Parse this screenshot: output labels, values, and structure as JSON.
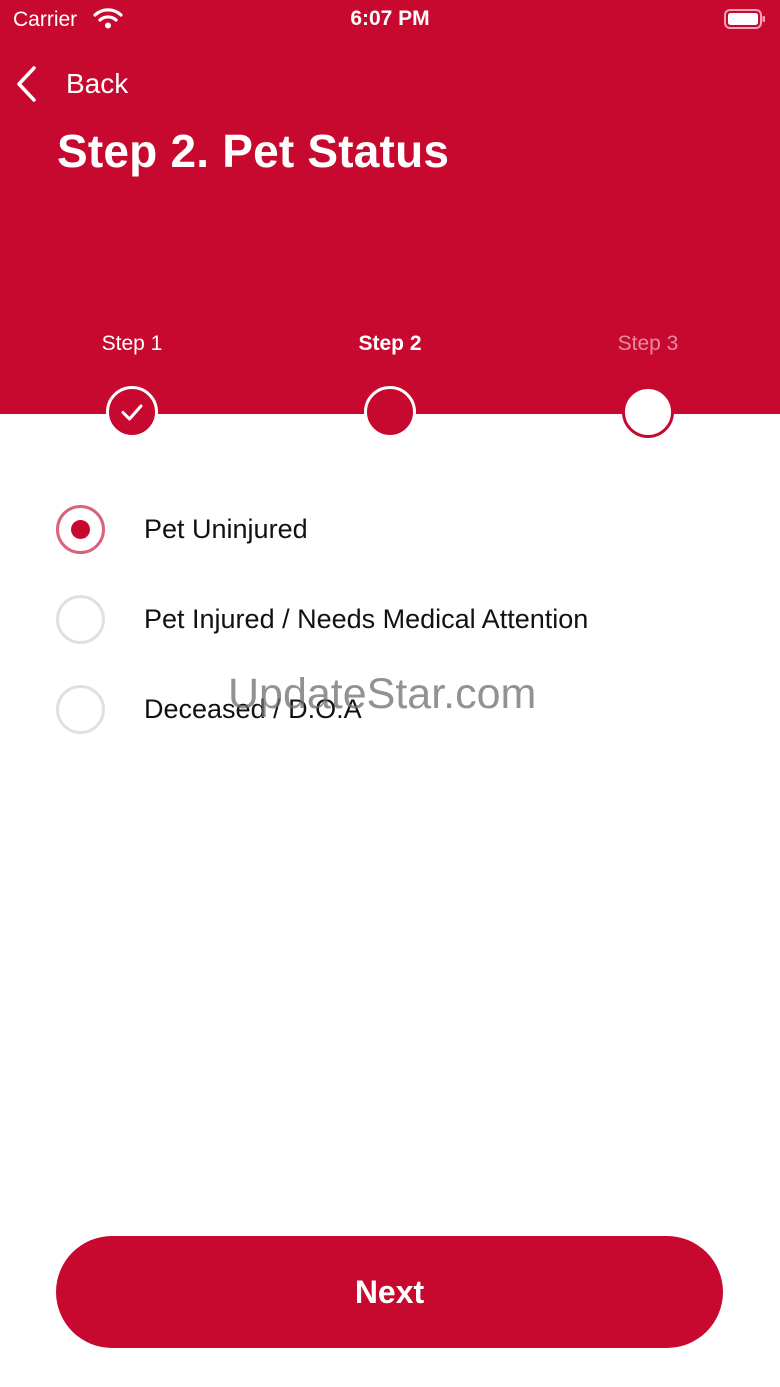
{
  "status_bar": {
    "carrier": "Carrier",
    "time": "6:07 PM"
  },
  "nav": {
    "back_label": "Back"
  },
  "page": {
    "title": "Step 2. Pet Status"
  },
  "stepper": {
    "steps": [
      {
        "label": "Step 1",
        "state": "completed"
      },
      {
        "label": "Step 2",
        "state": "current"
      },
      {
        "label": "Step 3",
        "state": "upcoming"
      }
    ]
  },
  "options": [
    {
      "label": "Pet Uninjured",
      "selected": true
    },
    {
      "label": "Pet Injured / Needs Medical Attention",
      "selected": false
    },
    {
      "label": "Deceased / D.O.A",
      "selected": false
    }
  ],
  "watermark": "UpdateStar.com",
  "footer": {
    "next_label": "Next"
  },
  "colors": {
    "brand": "#c8092f",
    "inactive_step_label": "#ea8a9f",
    "radio_border": "#e0e0e0"
  }
}
